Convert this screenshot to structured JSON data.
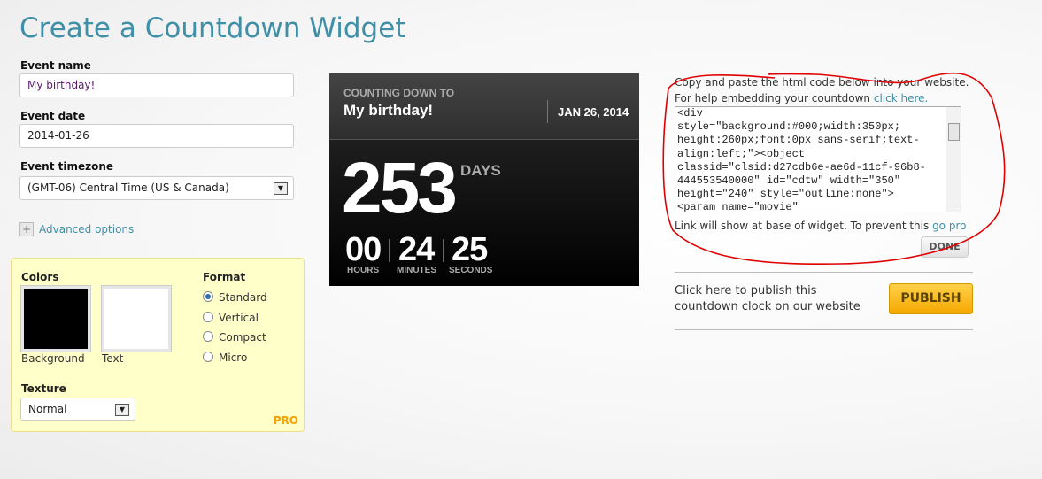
{
  "title": "Create a Countdown Widget",
  "form": {
    "event_name_label": "Event name",
    "event_name_value": "My birthday!",
    "event_date_label": "Event date",
    "event_date_value": "2014-01-26",
    "timezone_label": "Event timezone",
    "timezone_value": "(GMT-06) Central Time (US & Canada)",
    "advanced_options": "Advanced options"
  },
  "pro_panel": {
    "colors_label": "Colors",
    "background_label": "Background",
    "text_label": "Text",
    "background_color": "#000000",
    "text_color": "#ffffff",
    "format_label": "Format",
    "formats": [
      {
        "label": "Standard",
        "selected": true
      },
      {
        "label": "Vertical",
        "selected": false
      },
      {
        "label": "Compact",
        "selected": false
      },
      {
        "label": "Micro",
        "selected": false
      }
    ],
    "texture_label": "Texture",
    "texture_value": "Normal",
    "pro_badge": "PRO"
  },
  "widget": {
    "counting_down": "COUNTING DOWN TO",
    "event": "My birthday!",
    "date": "JAN 26, 2014",
    "days": "253",
    "days_label": "DAYS",
    "hours": "00",
    "hours_label": "HOURS",
    "minutes": "24",
    "minutes_label": "MINUTES",
    "seconds": "25",
    "seconds_label": "SECONDS"
  },
  "embed": {
    "instructions": "Copy and paste the html code below into your website.",
    "help_text": "For help embedding your countdown ",
    "help_link": "click here.",
    "code": "<div\nstyle=\"background:#000;width:350px;\nheight:260px;font:0px sans-serif;text-\nalign:left;\"><object\nclassid=\"clsid:d27cdb6e-ae6d-11cf-96b8-\n444553540000\" id=\"cdtw\" width=\"350\"\nheight=\"240\" style=\"outline:none\">\n<param name=\"movie\"",
    "link_note": "Link will show at base of widget. To prevent this ",
    "go_pro": "go pro",
    "done": "DONE"
  },
  "publish": {
    "text": "Click here to publish this countdown clock on our website",
    "button": "PUBLISH"
  },
  "colors": {
    "accent": "#3f8fa6",
    "publish": "#f8b800",
    "annotation": "#e00000"
  }
}
